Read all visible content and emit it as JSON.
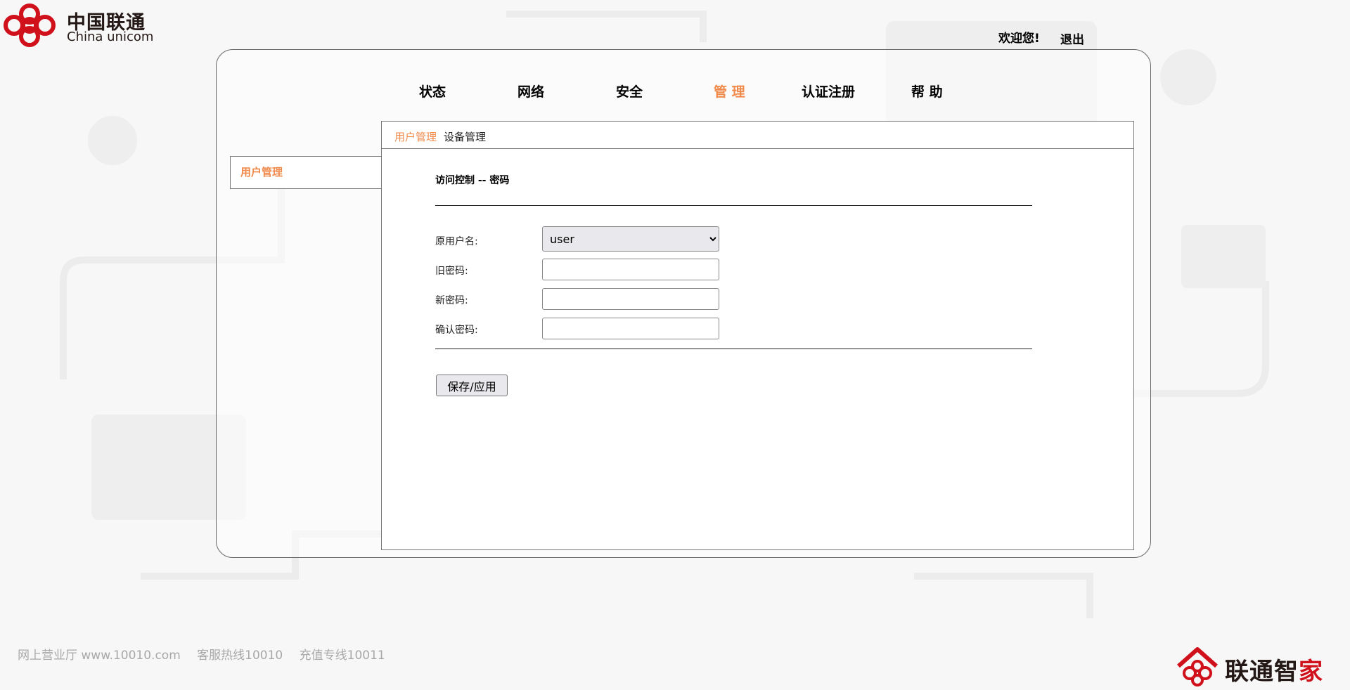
{
  "header": {
    "logo_cn": "中国联通",
    "logo_en": "China unicom",
    "welcome": "欢迎您!",
    "logout": "退出"
  },
  "nav": {
    "items": [
      "状态",
      "网络",
      "安全",
      "管 理",
      "认证注册",
      "帮 助"
    ],
    "active_index": 3
  },
  "subnav": {
    "items": [
      "用户管理",
      "设备管理"
    ],
    "active_index": 0
  },
  "sidebar": {
    "items": [
      "用户管理"
    ]
  },
  "form": {
    "title": "访问控制 -- 密码",
    "username_label": "原用户名:",
    "username_options": [
      "user"
    ],
    "username_value": "user",
    "old_password_label": "旧密码:",
    "new_password_label": "新密码:",
    "confirm_password_label": "确认密码:",
    "save_button": "保存/应用"
  },
  "footer": {
    "site": "网上营业厅 www.10010.com",
    "hotline": "客服热线10010",
    "recharge": "充值专线10011"
  },
  "brand": {
    "text_main": "联通智",
    "text_accent": "家"
  },
  "colors": {
    "accent": "#f08a4b",
    "logo_red": "#d0111b"
  }
}
